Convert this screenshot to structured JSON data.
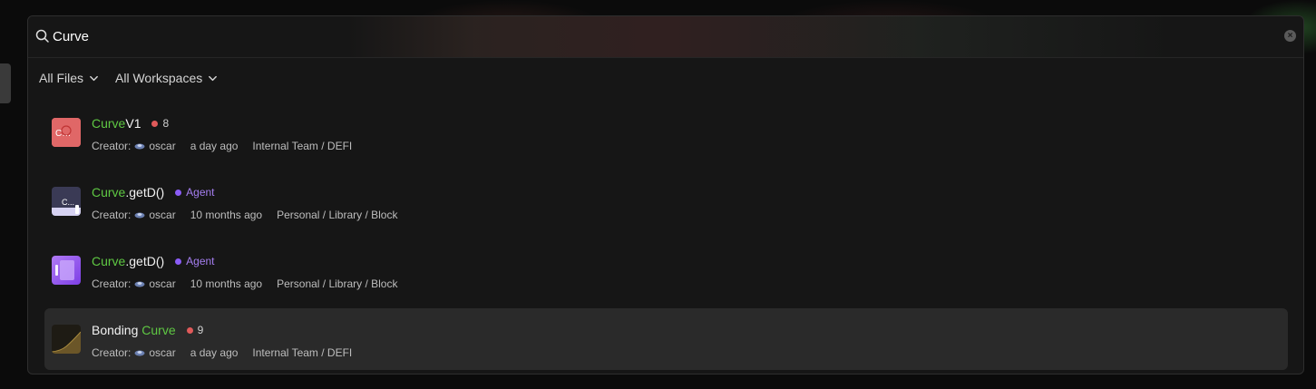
{
  "search": {
    "query": "Curve",
    "placeholder": ""
  },
  "filters": [
    {
      "label": "All Files"
    },
    {
      "label": "All Workspaces"
    }
  ],
  "results": [
    {
      "title_highlight": "Curve",
      "title_rest": "V1",
      "badge": {
        "type": "count",
        "value": "8",
        "color": "#e05a5a"
      },
      "creator_label": "Creator:",
      "creator_name": "oscar",
      "time": "a day ago",
      "path": "Internal Team / DEFI",
      "thumb_text": "C…",
      "thumb_color": "#e06767"
    },
    {
      "title_highlight": "Curve",
      "title_rest": ".getD()",
      "badge": {
        "type": "agent",
        "value": "Agent",
        "color": "#8b5cf6"
      },
      "creator_label": "Creator:",
      "creator_name": "oscar",
      "time": "10 months ago",
      "path": "Personal / Library / Block",
      "thumb_text": "C...",
      "thumb_color": "#3c3c5a"
    },
    {
      "title_highlight": "Curve",
      "title_rest": ".getD()",
      "badge": {
        "type": "agent",
        "value": "Agent",
        "color": "#8b5cf6"
      },
      "creator_label": "Creator:",
      "creator_name": "oscar",
      "time": "10 months ago",
      "path": "Personal / Library / Block",
      "thumb_text": "",
      "thumb_color": "#9a5df0"
    },
    {
      "title_prefix": "Bonding ",
      "title_highlight": "Curve",
      "title_rest": "",
      "badge": {
        "type": "count",
        "value": "9",
        "color": "#e05a5a"
      },
      "creator_label": "Creator:",
      "creator_name": "oscar",
      "time": "a day ago",
      "path": "Internal Team / DEFI",
      "thumb_text": "",
      "thumb_color": "#1e1b14"
    }
  ]
}
